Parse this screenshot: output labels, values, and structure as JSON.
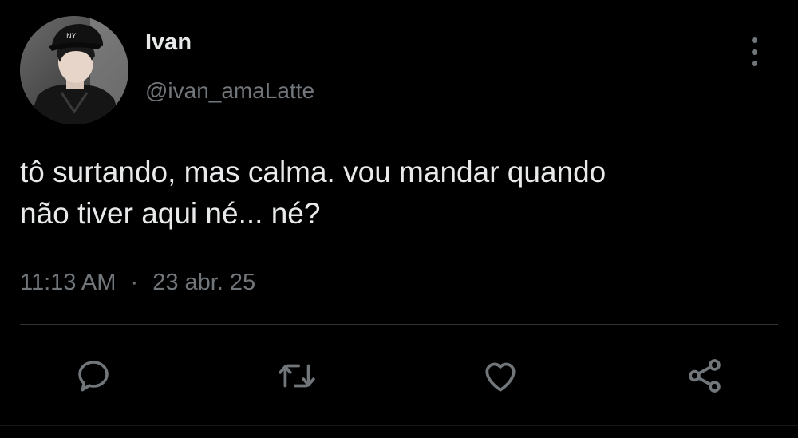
{
  "author": {
    "display_name": "Ivan",
    "handle": "@ivan_amaLatte"
  },
  "tweet": {
    "text_line1": "tô surtando, mas calma. vou mandar quando",
    "text_line2": "não tiver aqui né... né?",
    "time": "11:13 AM",
    "separator": "·",
    "date": "23 abr. 25"
  },
  "icons": {
    "reply": "reply-icon",
    "retweet": "retweet-icon",
    "like": "heart-icon",
    "share": "share-icon",
    "more": "more-vertical-icon"
  },
  "colors": {
    "background": "#000000",
    "text": "#e7e9ea",
    "secondary": "#71767b",
    "divider": "#2f3336"
  }
}
